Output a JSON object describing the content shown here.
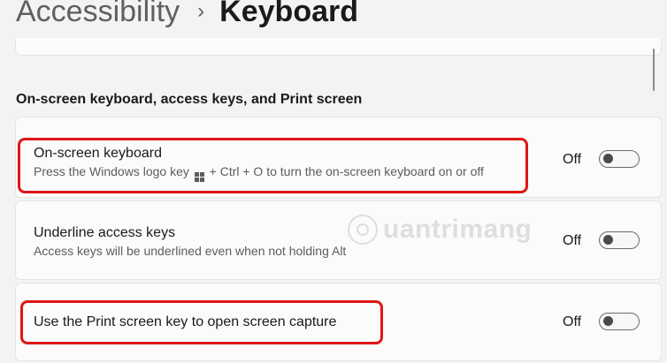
{
  "breadcrumb": {
    "parent": "Accessibility",
    "separator": "›",
    "current": "Keyboard"
  },
  "section": {
    "title": "On-screen keyboard, access keys, and Print screen"
  },
  "settings": [
    {
      "title": "On-screen keyboard",
      "description_before": "Press the Windows logo key",
      "description_icon": "windows-logo-icon",
      "description_after": "+ Ctrl + O to turn the on-screen keyboard on or off",
      "state_label": "Off",
      "on": false
    },
    {
      "title": "Underline access keys",
      "description": "Access keys will be underlined even when not holding Alt",
      "state_label": "Off",
      "on": false
    },
    {
      "title": "Use the Print screen key to open screen capture",
      "state_label": "Off",
      "on": false
    }
  ],
  "watermark": {
    "text": "uantrimang"
  },
  "colors": {
    "highlight": "#e01515",
    "card_background": "#fbfbfb",
    "page_background": "#f3f3f3"
  }
}
